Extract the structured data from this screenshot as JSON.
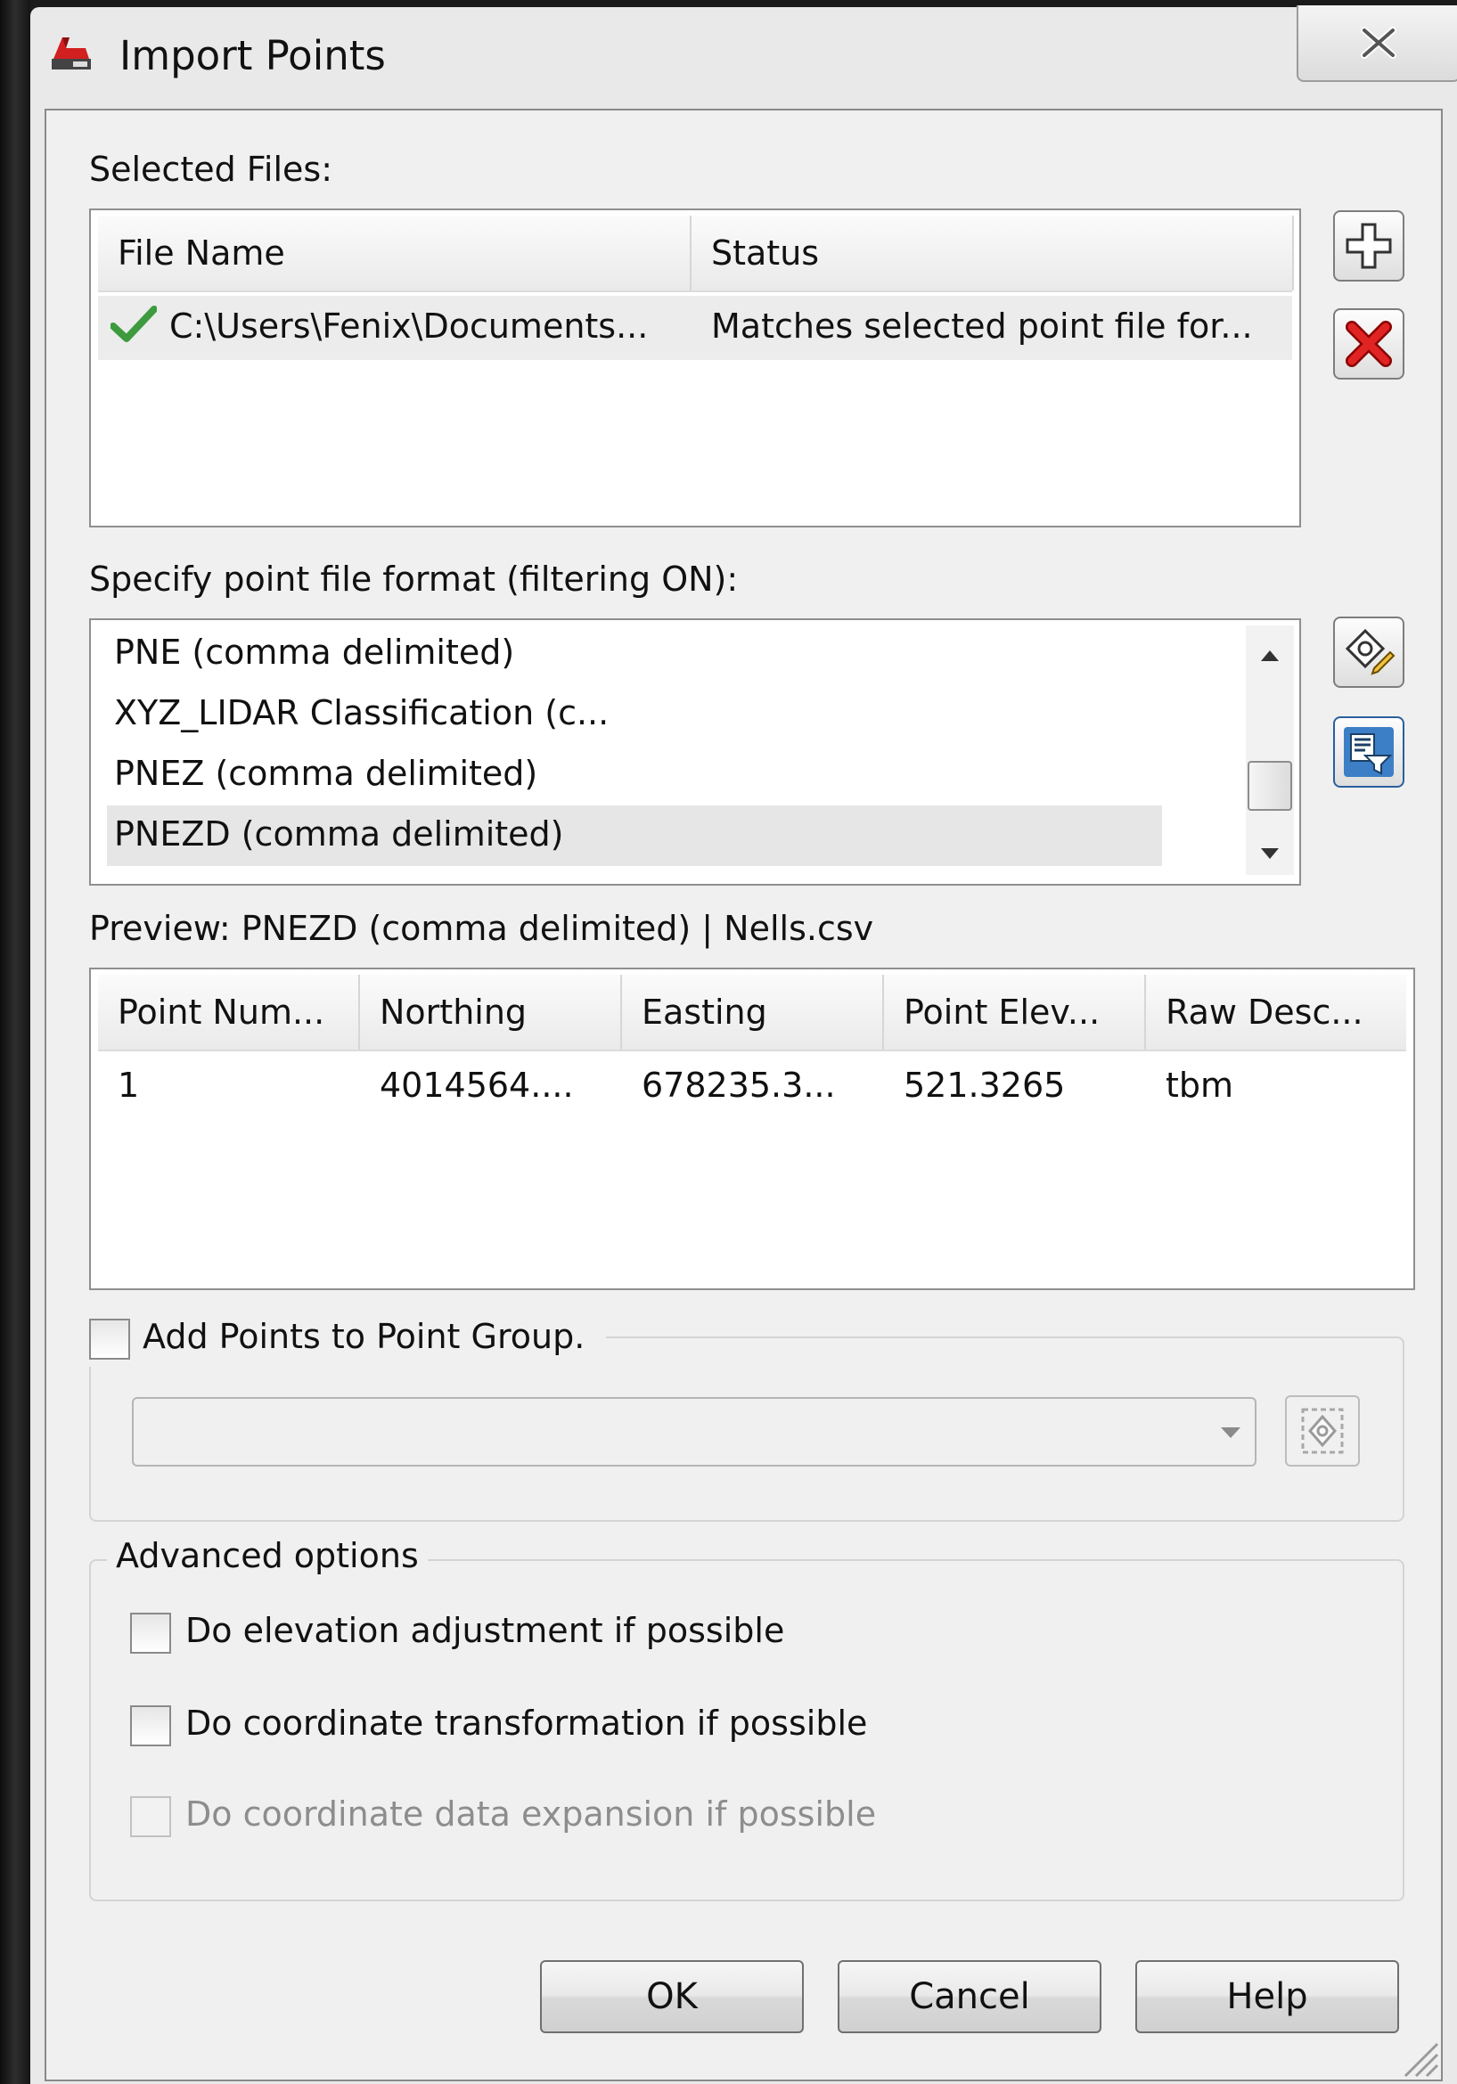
{
  "window": {
    "title": "Import Points",
    "app_icon": "civil3d-app-icon",
    "close_icon": "close-icon"
  },
  "selected_files": {
    "label": "Selected Files:",
    "columns": [
      "File Name",
      "Status"
    ],
    "rows": [
      {
        "status_icon": "checkmark-icon",
        "file_name": "C:\\Users\\Fenix\\Documents...",
        "status": "Matches selected point file for..."
      }
    ],
    "add_button_icon": "add-file-icon",
    "remove_button_icon": "remove-file-icon"
  },
  "format": {
    "label": "Specify point file format (filtering ON):",
    "items": [
      "PNE (comma delimited)",
      "XYZ_LIDAR Classification (c...",
      "PNEZ (comma delimited)",
      "PNEZD (comma delimited)"
    ],
    "selected_item": "PNEZD (comma delimited)",
    "manage_formats_icon": "manage-formats-icon",
    "filter_icon": "filter-formats-icon"
  },
  "preview": {
    "label": "Preview: PNEZD (comma delimited) | Nells.csv",
    "columns": [
      "Point Num...",
      "Northing",
      "Easting",
      "Point Elev...",
      "Raw Desc..."
    ],
    "rows": [
      [
        "1",
        "4014564....",
        "678235.3...",
        "521.3265",
        "tbm"
      ]
    ]
  },
  "point_group": {
    "checkbox_label": "Add Points to Point Group.",
    "checked": false,
    "dropdown_value": "",
    "pick_button_icon": "create-point-group-icon"
  },
  "advanced": {
    "legend": "Advanced options",
    "options": [
      {
        "label": "Do elevation adjustment if possible",
        "checked": false,
        "enabled": true
      },
      {
        "label": "Do coordinate transformation if possible",
        "checked": false,
        "enabled": true
      },
      {
        "label": "Do coordinate data expansion if possible",
        "checked": false,
        "enabled": false
      }
    ]
  },
  "buttons": {
    "ok": "OK",
    "cancel": "Cancel",
    "help": "Help"
  }
}
